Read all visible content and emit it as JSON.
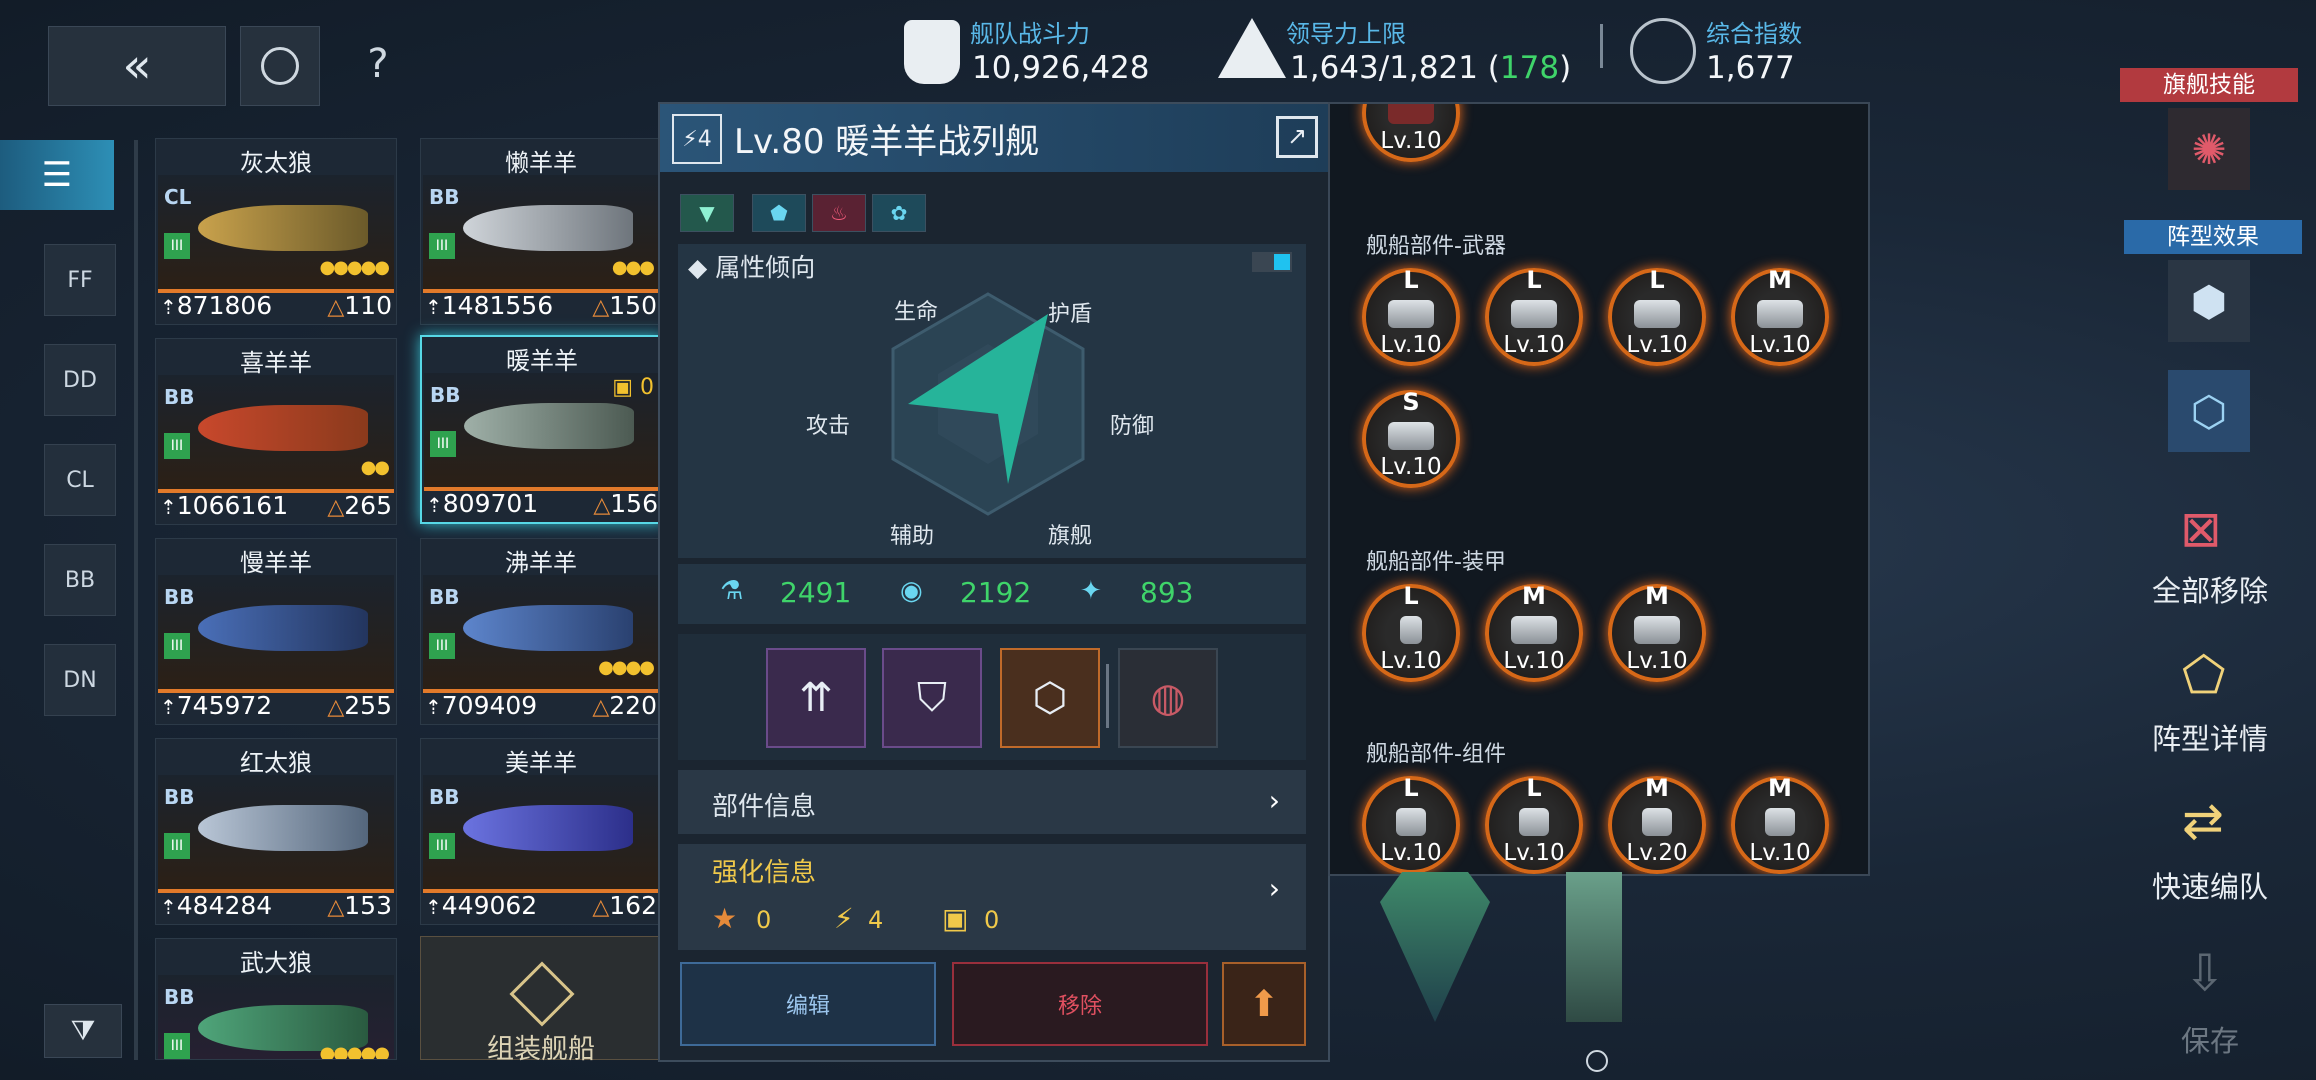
{
  "top": {
    "fleet_power_label": "舰队战斗力",
    "fleet_power_value": "10,926,428",
    "leadership_label": "领导力上限",
    "leadership_value": "1,643/1,821 (",
    "leadership_bonus": "178",
    "leadership_close": ")",
    "composite_label": "综合指数",
    "composite_value": "1,677"
  },
  "categories": [
    "FF",
    "DD",
    "CL",
    "BB",
    "DN"
  ],
  "ships": [
    {
      "name": "灰太狼",
      "class": "CL",
      "power": "871806",
      "cost": "110",
      "dots": "●●●●●"
    },
    {
      "name": "懒羊羊",
      "class": "BB",
      "power": "1481556",
      "cost": "150",
      "dots": "●●●"
    },
    {
      "name": "喜羊羊",
      "class": "BB",
      "power": "1066161",
      "cost": "265",
      "dots": "●●"
    },
    {
      "name": "暖羊羊",
      "class": "BB",
      "power": "809701",
      "cost": "156",
      "dots": "",
      "badge": "0"
    },
    {
      "name": "慢羊羊",
      "class": "BB",
      "power": "745972",
      "cost": "255",
      "dots": ""
    },
    {
      "name": "沸羊羊",
      "class": "BB",
      "power": "709409",
      "cost": "220",
      "dots": "●●●●"
    },
    {
      "name": "红太狼",
      "class": "BB",
      "power": "484284",
      "cost": "153",
      "dots": ""
    },
    {
      "name": "美羊羊",
      "class": "BB",
      "power": "449062",
      "cost": "162",
      "dots": ""
    },
    {
      "name": "武大狼",
      "class": "BB",
      "power": "",
      "cost": "",
      "dots": "●●●●●"
    }
  ],
  "assemble_label": "组装舰船",
  "detail": {
    "badge": "4",
    "title": "Lv.80 暖羊羊战列舰",
    "attr_title": "属性倾向",
    "radar": {
      "hp": "生命",
      "shield": "护盾",
      "attack": "攻击",
      "defense": "防御",
      "support": "辅助",
      "flagship": "旗舰"
    },
    "stat1": "2491",
    "stat2": "2192",
    "stat3": "893",
    "parts_info": "部件信息",
    "enhance_title": "强化信息",
    "enh1": "0",
    "enh2": "4",
    "enh3": "0",
    "edit_btn": "编辑",
    "remove_btn": "移除"
  },
  "parts": {
    "weapon_title": "舰船部件-武器",
    "armor_title": "舰船部件-装甲",
    "component_title": "舰船部件-组件",
    "top_lv": "Lv.10",
    "weapons": [
      {
        "g": "L",
        "lv": "Lv.10"
      },
      {
        "g": "L",
        "lv": "Lv.10"
      },
      {
        "g": "L",
        "lv": "Lv.10"
      },
      {
        "g": "M",
        "lv": "Lv.10"
      },
      {
        "g": "S",
        "lv": "Lv.10"
      }
    ],
    "armor": [
      {
        "g": "L",
        "lv": "Lv.10"
      },
      {
        "g": "M",
        "lv": "Lv.10"
      },
      {
        "g": "M",
        "lv": "Lv.10"
      }
    ],
    "components": [
      {
        "g": "L",
        "lv": "Lv.10"
      },
      {
        "g": "L",
        "lv": "Lv.10"
      },
      {
        "g": "M",
        "lv": "Lv.20"
      },
      {
        "g": "M",
        "lv": "Lv.10"
      }
    ]
  },
  "right": {
    "flagship_skill": "旗舰技能",
    "formation_effect": "阵型效果",
    "remove_all": "全部移除",
    "formation_detail": "阵型详情",
    "quick_form": "快速编队",
    "save": "保存"
  },
  "colors": {
    "accent_cyan": "#57d8e6",
    "orange": "#e27a2a",
    "green": "#3fd46a",
    "red_label": "#b23a3f"
  }
}
